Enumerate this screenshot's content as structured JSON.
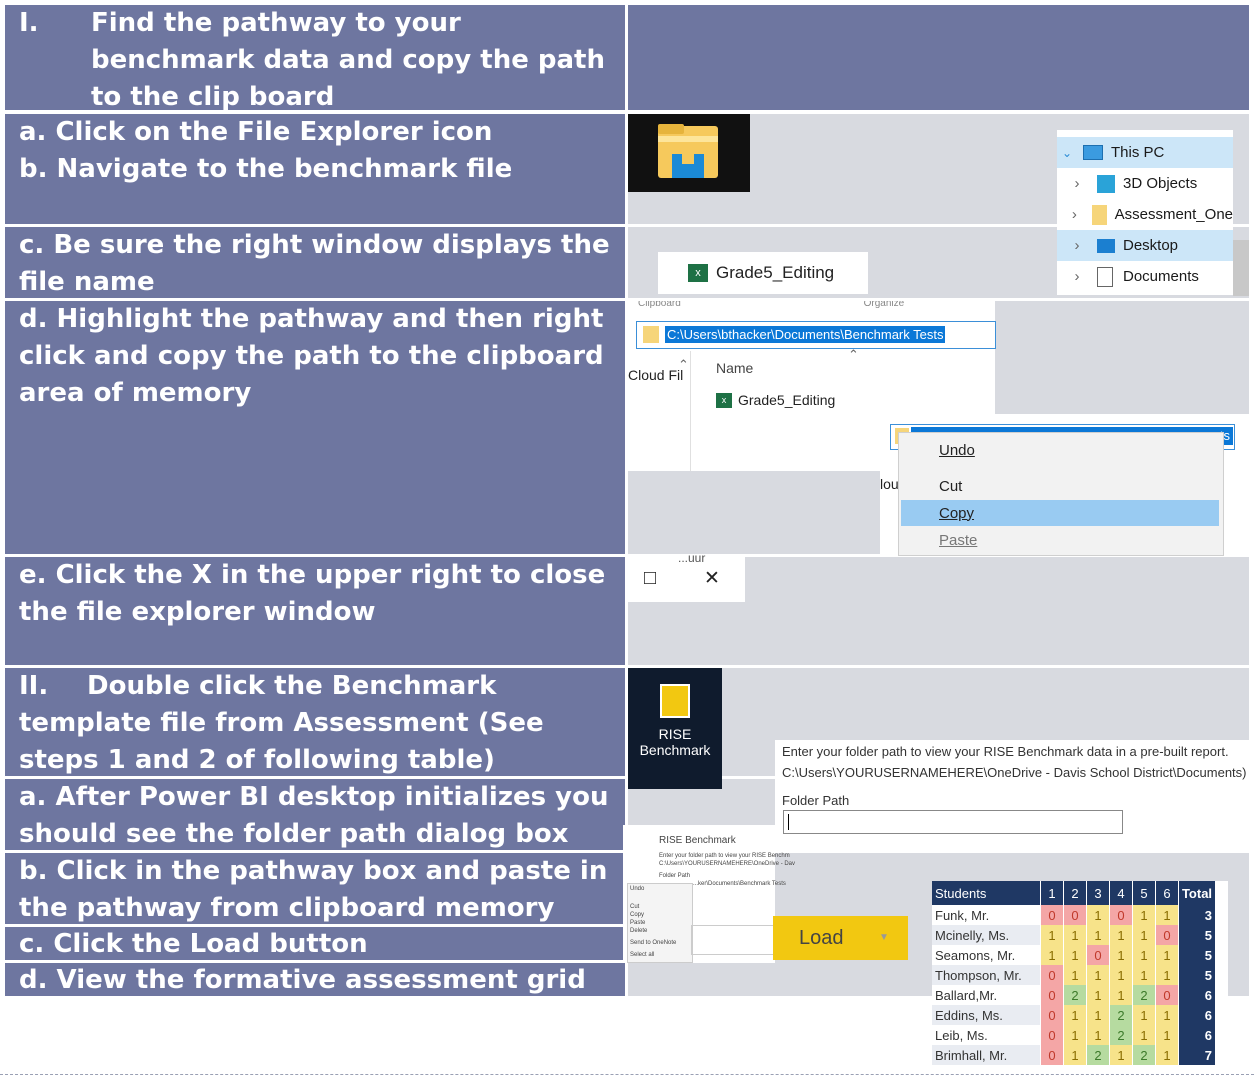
{
  "steps": {
    "s1": {
      "num": "I.",
      "text": "Find the pathway to your benchmark data and copy the path to the clip board"
    },
    "s1a": {
      "line1": "a. Click on the File Explorer icon",
      "line2": "b. Navigate to the benchmark file"
    },
    "s1c": "c. Be sure the right window displays the file name",
    "s1d": "d. Highlight the pathway and then right click and copy the path to the clipboard area of memory",
    "s1e": {
      "pre": "e. Click the ",
      "x": "X",
      "post": " in the upper right to close the file explorer window"
    },
    "s2": {
      "num": "II.",
      "text": "Double click the Benchmark template file from Assessment (See steps 1 and 2 of following table)"
    },
    "s2a": "a. After Power BI desktop initializes you should see the folder path dialog box",
    "s2b": "b. Click in the pathway box and paste in the pathway from clipboard memory",
    "s2c": "c. Click the Load button",
    "s2d": "d. View the formative assessment grid"
  },
  "explorer": {
    "tree": [
      "This PC",
      "3D Objects",
      "Assessment_One",
      "Desktop",
      "Documents"
    ],
    "file_name": "Grade5_Editing",
    "address": "C:\\Users\\bthacker\\Documents\\Benchmark Tests",
    "column_name": "Name",
    "side_label": "Cloud Fil",
    "side_label2": "lou",
    "address_tail": "ts",
    "clipped_text_top": "Clipboard",
    "clipped_text_top2": "Organize",
    "clipped_text_e": "...uur",
    "context_menu": {
      "undo": "Undo",
      "cut": "Cut",
      "copy": "Copy",
      "paste": "Paste"
    },
    "window_buttons": {
      "maximize": "□",
      "close": "✕"
    }
  },
  "powerbi": {
    "app_label_1": "RISE",
    "app_label_2": "Benchmark",
    "dialog_line1": "Enter your folder path to view your RISE Benchmark data in a pre-built report.",
    "dialog_line2": "C:\\Users\\YOURUSERNAMEHERE\\OneDrive - Davis School District\\Documents)",
    "folder_label": "Folder Path",
    "mini_title": "RISE Benchmark",
    "mini_line1": "Enter your folder path to view your RISE Benchm",
    "mini_line2": "C:\\Users\\YOURUSERNAMEHERE\\OneDrive - Dav",
    "mini_folder": "Folder Path",
    "mini_path": "...ker\\Documents\\Benchmark Tests",
    "mini_menu": [
      "Undo",
      "Cut",
      "Copy",
      "Paste",
      "Delete",
      "Send to OneNote",
      "Select all"
    ],
    "load_label": "Load",
    "load_arrow": "▼"
  },
  "grid": {
    "header": [
      "Students",
      "1",
      "2",
      "3",
      "4",
      "5",
      "6",
      "Total"
    ],
    "rows": [
      {
        "name": "Funk, Mr.",
        "scores": [
          "0",
          "0",
          "1",
          "0",
          "1",
          "1"
        ],
        "total": "3"
      },
      {
        "name": "Mcinelly, Ms.",
        "scores": [
          "1",
          "1",
          "1",
          "1",
          "1",
          "0"
        ],
        "total": "5"
      },
      {
        "name": "Seamons, Mr.",
        "scores": [
          "1",
          "1",
          "0",
          "1",
          "1",
          "1"
        ],
        "total": "5"
      },
      {
        "name": "Thompson, Mr.",
        "scores": [
          "0",
          "1",
          "1",
          "1",
          "1",
          "1"
        ],
        "total": "5"
      },
      {
        "name": "Ballard,Mr.",
        "scores": [
          "0",
          "2",
          "1",
          "1",
          "2",
          "0"
        ],
        "total": "6"
      },
      {
        "name": "Eddins, Ms.",
        "scores": [
          "0",
          "1",
          "1",
          "2",
          "1",
          "1"
        ],
        "total": "6"
      },
      {
        "name": "Leib, Ms.",
        "scores": [
          "0",
          "1",
          "1",
          "2",
          "1",
          "1"
        ],
        "total": "6"
      },
      {
        "name": "Brimhall, Mr.",
        "scores": [
          "0",
          "1",
          "2",
          "1",
          "2",
          "1"
        ],
        "total": "7"
      }
    ],
    "colors": {
      "header": "#1f3864",
      "zero": "#f4a6a6",
      "one": "#f7e38a",
      "two": "#b6dba0",
      "total": "#1f3864"
    }
  }
}
